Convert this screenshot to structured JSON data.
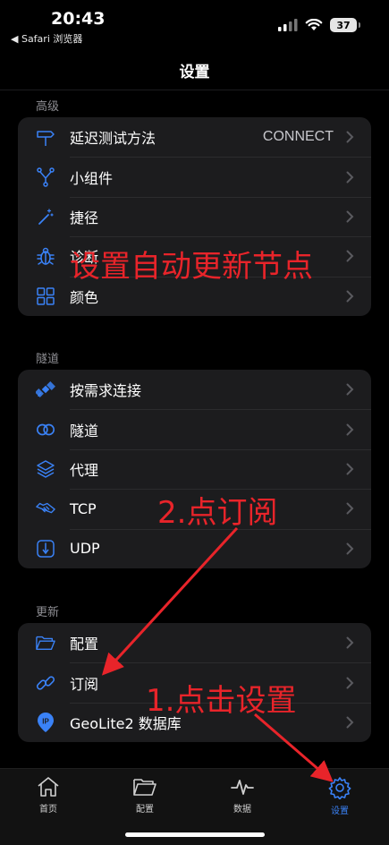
{
  "status_bar": {
    "time": "20:43",
    "back_app": "◀ Safari 浏览器",
    "battery": "37"
  },
  "nav": {
    "title": "设置"
  },
  "sections": {
    "advanced": {
      "header": "高级",
      "items": [
        {
          "label": "延迟测试方法",
          "value": "CONNECT",
          "icon": "signpost-icon"
        },
        {
          "label": "小组件",
          "icon": "widget-icon"
        },
        {
          "label": "捷径",
          "icon": "magic-wand-icon"
        },
        {
          "label": "诊断",
          "icon": "bug-icon"
        },
        {
          "label": "颜色",
          "icon": "grid-icon"
        }
      ]
    },
    "tunnel": {
      "header": "隧道",
      "items": [
        {
          "label": "按需求连接",
          "icon": "satellite-icon"
        },
        {
          "label": "隧道",
          "icon": "toggle-icon"
        },
        {
          "label": "代理",
          "icon": "layers-icon"
        },
        {
          "label": "TCP",
          "icon": "handshake-icon"
        },
        {
          "label": "UDP",
          "icon": "udp-icon"
        }
      ]
    },
    "update": {
      "header": "更新",
      "items": [
        {
          "label": "配置",
          "icon": "folder-icon"
        },
        {
          "label": "订阅",
          "icon": "link-icon"
        },
        {
          "label": "GeoLite2 数据库",
          "icon": "ip-location-icon"
        }
      ]
    }
  },
  "tabs": [
    {
      "label": "首页",
      "icon": "home-icon"
    },
    {
      "label": "配置",
      "icon": "folder-icon"
    },
    {
      "label": "数据",
      "icon": "pulse-icon"
    },
    {
      "label": "设置",
      "icon": "gear-icon",
      "active": true
    }
  ],
  "annotations": {
    "note_auto_update": "设置自动更新节点",
    "note_step2": "2.点订阅",
    "note_step1": "1.点击设置"
  },
  "colors": {
    "accent": "#3a82f7",
    "annotation": "#e8242a",
    "group_bg": "#1c1c1e"
  }
}
